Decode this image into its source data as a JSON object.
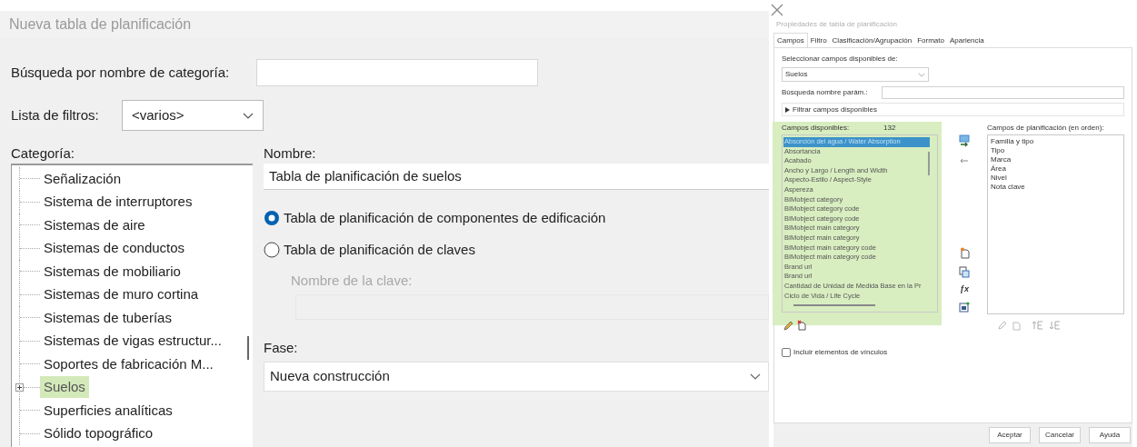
{
  "left_dialog": {
    "title": "Nueva tabla de planificación",
    "category_search": {
      "label": "Búsqueda por nombre de categoría:"
    },
    "filter_list": {
      "label": "Lista de filtros:",
      "value": "<varios>"
    },
    "category": {
      "label": "Categoría:",
      "items": [
        {
          "label": "Señalización",
          "has_children": false,
          "highlighted": false
        },
        {
          "label": "Sistema de interruptores",
          "has_children": false,
          "highlighted": false
        },
        {
          "label": "Sistemas de aire",
          "has_children": false,
          "highlighted": false
        },
        {
          "label": "Sistemas de conductos",
          "has_children": false,
          "highlighted": false
        },
        {
          "label": "Sistemas de mobiliario",
          "has_children": false,
          "highlighted": false
        },
        {
          "label": "Sistemas de muro cortina",
          "has_children": false,
          "highlighted": false
        },
        {
          "label": "Sistemas de tuberías",
          "has_children": false,
          "highlighted": false
        },
        {
          "label": "Sistemas de vigas estructur...",
          "has_children": false,
          "highlighted": false
        },
        {
          "label": "Soportes de fabricación M...",
          "has_children": false,
          "highlighted": false
        },
        {
          "label": "Suelos",
          "has_children": true,
          "highlighted": true
        },
        {
          "label": "Superficies analíticas",
          "has_children": false,
          "highlighted": false
        },
        {
          "label": "Sólido topográfico",
          "has_children": false,
          "highlighted": false
        }
      ]
    },
    "name": {
      "label": "Nombre:",
      "value": "Tabla de planificación de suelos"
    },
    "schedule_types": [
      {
        "label": "Tabla de planificación de componentes de edificación",
        "selected": true
      },
      {
        "label": "Tabla de planificación de claves",
        "selected": false
      }
    ],
    "key_name": {
      "label": "Nombre de la clave:",
      "disabled": true
    },
    "phase": {
      "label": "Fase:",
      "value": "Nueva construcción"
    }
  },
  "right_dialog": {
    "title": "Propiedades de tabla de planificación",
    "tabs": [
      {
        "label": "Campos",
        "selected": true
      },
      {
        "label": "Filtro",
        "selected": false
      },
      {
        "label": "Clasificación/Agrupación",
        "selected": false
      },
      {
        "label": "Formato",
        "selected": false
      },
      {
        "label": "Apariencia",
        "selected": false
      }
    ],
    "select_from": {
      "label": "Seleccionar campos disponibles de:",
      "value": "Suelos"
    },
    "param_search": {
      "label": "Búsqueda nombre parám.:"
    },
    "filter_toggle": {
      "label": "Filtrar campos disponibles",
      "expanded": false
    },
    "available": {
      "label": "Campos disponibles:",
      "count": "132",
      "highlighted": true,
      "items": [
        {
          "label": "Absorción del agua / Water Absorption",
          "selected": true
        },
        {
          "label": "Absortancia",
          "selected": false
        },
        {
          "label": "Acabado",
          "selected": false
        },
        {
          "label": "Ancho y Largo / Length and Width",
          "selected": false
        },
        {
          "label": "Aspecto-Estilo / Aspect-Style",
          "selected": false
        },
        {
          "label": "Aspereza",
          "selected": false
        },
        {
          "label": "BIMobject category",
          "selected": false
        },
        {
          "label": "BIMobject category code",
          "selected": false
        },
        {
          "label": "BIMobject category code",
          "selected": false
        },
        {
          "label": "BIMobject main category",
          "selected": false
        },
        {
          "label": "BIMobject main category",
          "selected": false
        },
        {
          "label": "BIMobject main category code",
          "selected": false
        },
        {
          "label": "BIMobject main category code",
          "selected": false
        },
        {
          "label": "Brand url",
          "selected": false
        },
        {
          "label": "Brand url",
          "selected": false
        },
        {
          "label": "Cantidad de Unidad de Medida Base en la Pr",
          "selected": false
        },
        {
          "label": "Ciclo de Vida / Life Cycle",
          "selected": false
        }
      ]
    },
    "formula_button": "ƒx",
    "scheduled": {
      "label": "Campos de planificación (en orden):",
      "items": [
        "Familia y tipo",
        "Tipo",
        "Marca",
        "Área",
        "Nivel",
        "Nota clave"
      ]
    },
    "include_links": {
      "label": "Incluir elementos de vínculos",
      "checked": false
    },
    "buttons": [
      "Aceptar",
      "Cancelar",
      "Ayuda"
    ]
  }
}
